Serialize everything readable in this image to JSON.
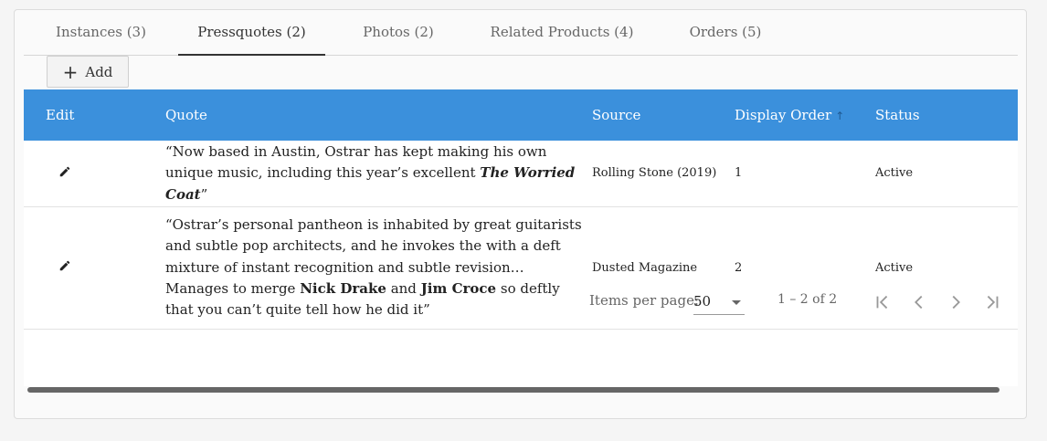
{
  "tabs": [
    {
      "label": "Instances (3)"
    },
    {
      "label": "Pressquotes (2)"
    },
    {
      "label": "Photos (2)"
    },
    {
      "label": "Related Products (4)"
    },
    {
      "label": "Orders (5)"
    }
  ],
  "active_tab": "Pressquotes (2)",
  "toolbar": {
    "add_label": "Add"
  },
  "table": {
    "headers": {
      "edit": "Edit",
      "quote": "Quote",
      "source": "Source",
      "display_order": "Display Order",
      "status": "Status"
    },
    "sorted_column": "Display Order",
    "sort_direction": "ascending",
    "rows": [
      {
        "quote_parts": [
          {
            "text": "“Now based in Austin, Ostrar has kept making his own unique music, including this year’s excellent ",
            "style": "normal"
          },
          {
            "text": "The Worried Coat",
            "style": "bold-italic"
          },
          {
            "text": "”",
            "style": "normal"
          }
        ],
        "source": "Rolling Stone (2019)",
        "display_order": "1",
        "status": "Active"
      },
      {
        "quote_parts": [
          {
            "text": "“Ostrar’s personal pantheon is inhabited by great guitarists and subtle pop architects, and he invokes the with a deft mixture of instant recognition and subtle revision…Manages to merge ",
            "style": "normal"
          },
          {
            "text": "Nick Drake",
            "style": "bold"
          },
          {
            "text": " and ",
            "style": "normal"
          },
          {
            "text": "Jim Croce",
            "style": "bold"
          },
          {
            "text": " so deftly that you can’t quite tell how he did it”",
            "style": "normal"
          }
        ],
        "source": "Dusted Magazine",
        "display_order": "2",
        "status": "Active"
      }
    ]
  },
  "paginator": {
    "items_per_page_label": "Items per page:",
    "items_per_page_value": "50",
    "range_label": "1 – 2 of 2"
  },
  "colors": {
    "header_bg": "#3b90dc",
    "header_text": "#ffffff"
  },
  "icons": [
    "plus-icon",
    "pencil-icon",
    "caret-down-icon",
    "first-page-icon",
    "previous-page-icon",
    "next-page-icon",
    "last-page-icon"
  ]
}
